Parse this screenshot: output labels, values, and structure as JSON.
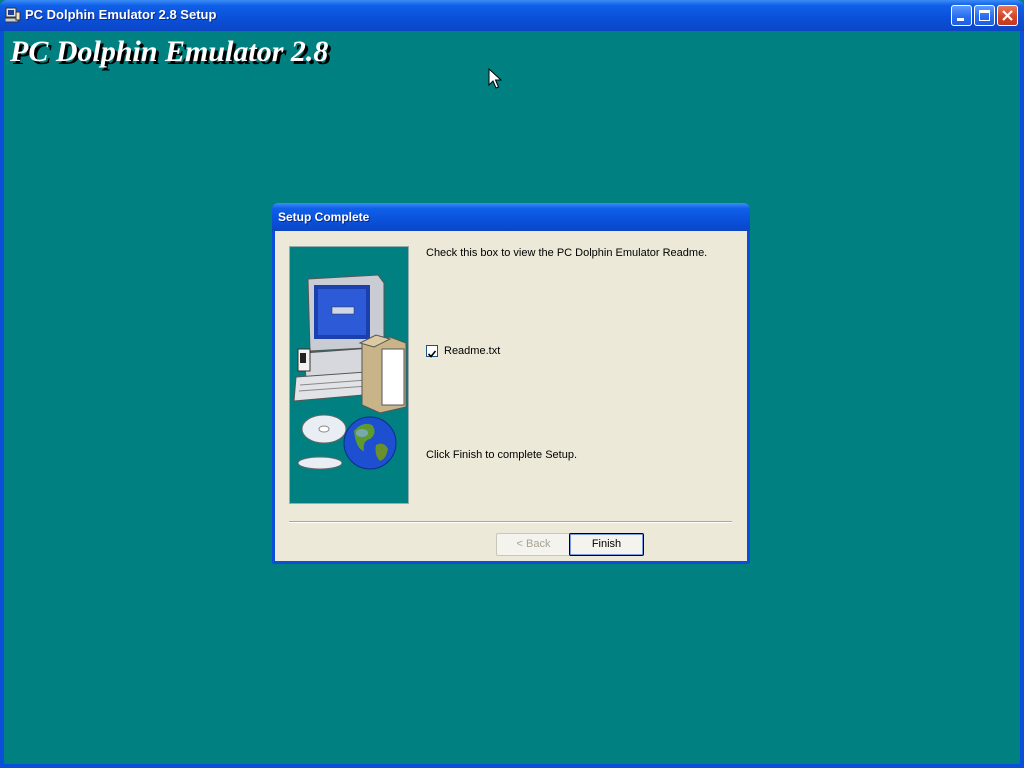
{
  "window": {
    "title": "PC Dolphin Emulator 2.8 Setup",
    "banner": "PC Dolphin Emulator 2.8",
    "background_color": "#008080",
    "controls": [
      "minimize-icon",
      "maximize-icon",
      "close-icon"
    ]
  },
  "dialog": {
    "title": "Setup Complete",
    "instruction": "Check this box to view the PC Dolphin Emulator Readme.",
    "checkbox": {
      "label": "Readme.txt",
      "checked": true
    },
    "footer_text": "Click Finish to complete Setup.",
    "buttons": {
      "back": "< Back",
      "finish": "Finish"
    },
    "back_enabled": false,
    "side_image": "computer-and-globe-illustration"
  },
  "colors": {
    "titlebar": "#0a50d8",
    "dialog_face": "#ece9d8",
    "desktop_teal": "#008080"
  }
}
